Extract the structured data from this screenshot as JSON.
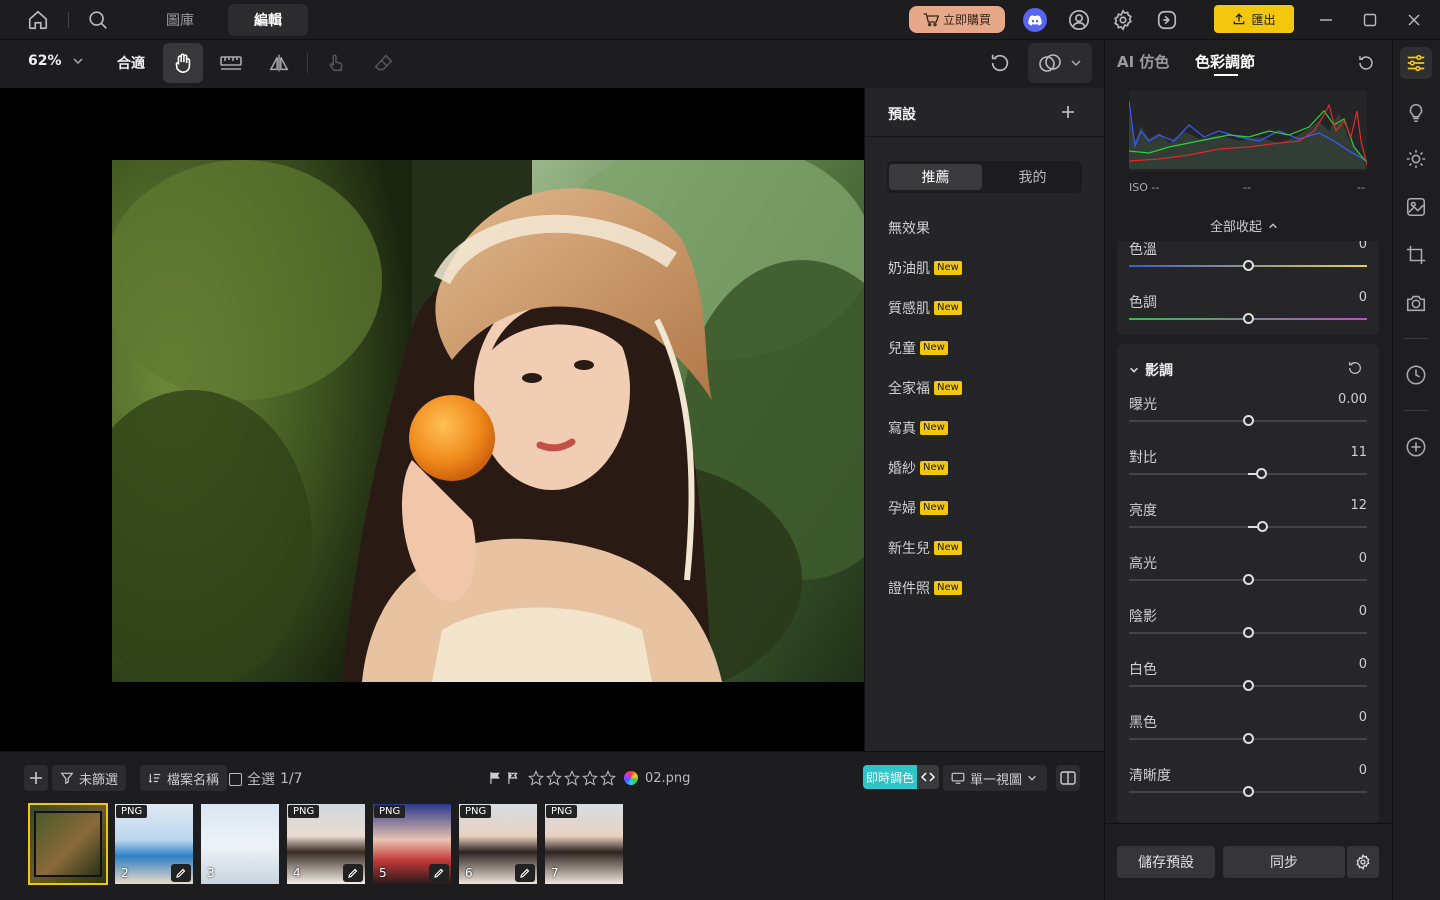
{
  "titlebar": {
    "tabs": [
      {
        "label": "圖庫"
      },
      {
        "label": "編輯"
      }
    ],
    "buy_label": "立即購買",
    "export_label": "匯出"
  },
  "toolbar": {
    "zoom": "62%",
    "fit_label": "合適"
  },
  "presets": {
    "title": "預設",
    "tabs": [
      {
        "label": "推薦"
      },
      {
        "label": "我的"
      }
    ],
    "items": [
      {
        "label": "無效果",
        "badge": ""
      },
      {
        "label": "奶油肌",
        "badge": "New"
      },
      {
        "label": "質感肌",
        "badge": "New"
      },
      {
        "label": "兒童",
        "badge": "New"
      },
      {
        "label": "全家福",
        "badge": "New"
      },
      {
        "label": "寫真",
        "badge": "New"
      },
      {
        "label": "婚紗",
        "badge": "New"
      },
      {
        "label": "孕婦",
        "badge": "New"
      },
      {
        "label": "新生兒",
        "badge": "New"
      },
      {
        "label": "證件照",
        "badge": "New"
      }
    ]
  },
  "right_panel": {
    "tabs": [
      {
        "label": "AI 仿色"
      },
      {
        "label": "色彩調節"
      }
    ],
    "histogram": {
      "iso": "ISO --",
      "v2": "--",
      "v3": "--"
    },
    "collapse_label": "全部收起",
    "color": {
      "sliders": [
        {
          "label": "色溫",
          "value": "0",
          "level": 0.5
        },
        {
          "label": "色調",
          "value": "0",
          "level": 0.5
        }
      ]
    },
    "tone": {
      "title": "影調",
      "sliders": [
        {
          "label": "曝光",
          "value": "0.00",
          "level": 0.5
        },
        {
          "label": "對比",
          "value": "11",
          "level": 0.555
        },
        {
          "label": "亮度",
          "value": "12",
          "level": 0.56
        },
        {
          "label": "高光",
          "value": "0",
          "level": 0.5
        },
        {
          "label": "陰影",
          "value": "0",
          "level": 0.5
        },
        {
          "label": "白色",
          "value": "0",
          "level": 0.5
        },
        {
          "label": "黑色",
          "value": "0",
          "level": 0.5
        },
        {
          "label": "清晰度",
          "value": "0",
          "level": 0.5
        }
      ]
    },
    "save_preset_label": "儲存預設",
    "sync_label": "同步"
  },
  "bottom": {
    "filter_label": "未篩選",
    "sort_label": "檔案名稱",
    "select_all_label": "全選",
    "count": "1/7",
    "filename": "02.png",
    "live_label": "即時調色",
    "view_label": "單一視圖",
    "thumbs": [
      {
        "num": "",
        "badge": ""
      },
      {
        "num": "2",
        "badge": "PNG"
      },
      {
        "num": "3",
        "badge": ""
      },
      {
        "num": "4",
        "badge": "PNG"
      },
      {
        "num": "5",
        "badge": "PNG"
      },
      {
        "num": "6",
        "badge": "PNG"
      },
      {
        "num": "7",
        "badge": "PNG"
      }
    ]
  },
  "colors": {
    "accent": "#f2c70d",
    "buy": "#e7a88a",
    "live": "#2ec4c8"
  }
}
